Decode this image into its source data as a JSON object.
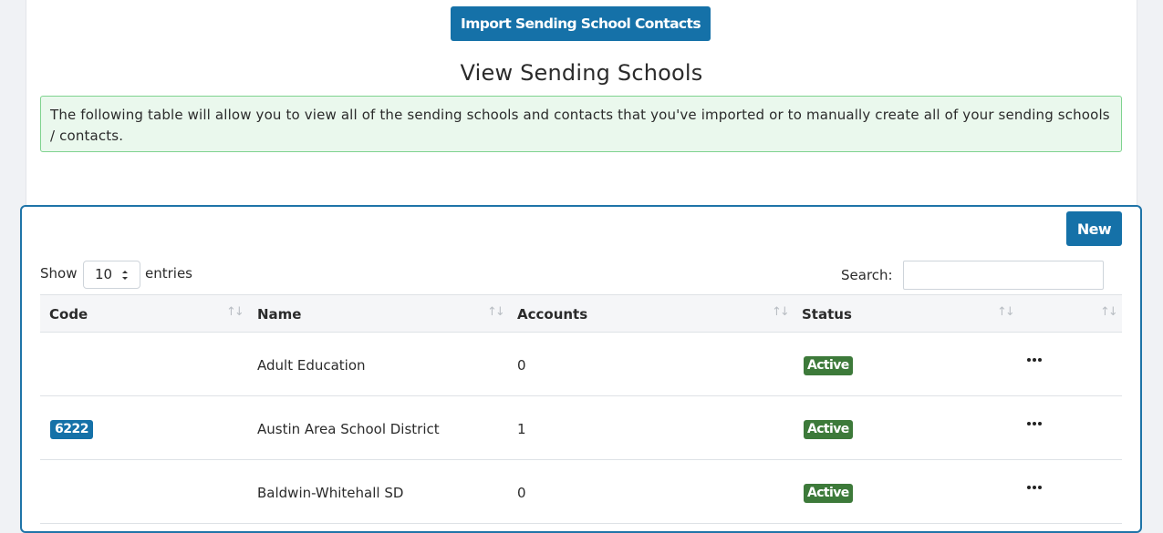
{
  "toolbar": {
    "import_label": "Import Sending School Contacts"
  },
  "page": {
    "title": "View Sending Schools",
    "info": "The following table will allow you to view all of the sending schools and contacts that you've imported or to manually create all of your sending schools / contacts."
  },
  "card": {
    "new_label": "New",
    "show_label": "Show",
    "entries_label": "entries",
    "page_length": "10",
    "search_label": "Search:",
    "search_value": ""
  },
  "table": {
    "columns": [
      "Code",
      "Name",
      "Accounts",
      "Status"
    ],
    "rows": [
      {
        "code": "",
        "name": "Adult Education",
        "accounts": "0",
        "status": "Active"
      },
      {
        "code": "6222",
        "name": "Austin Area School District",
        "accounts": "1",
        "status": "Active"
      },
      {
        "code": "",
        "name": "Baldwin-Whitehall SD",
        "accounts": "0",
        "status": "Active"
      }
    ]
  },
  "colors": {
    "primary": "#1571a8",
    "success": "#3d7a3a",
    "info_bg": "#eaf8ed",
    "info_border": "#7fd38f"
  },
  "icons": {
    "sort": "sort-arrows-icon",
    "more": "more-horizontal-icon",
    "select": "select-caret-icon"
  }
}
